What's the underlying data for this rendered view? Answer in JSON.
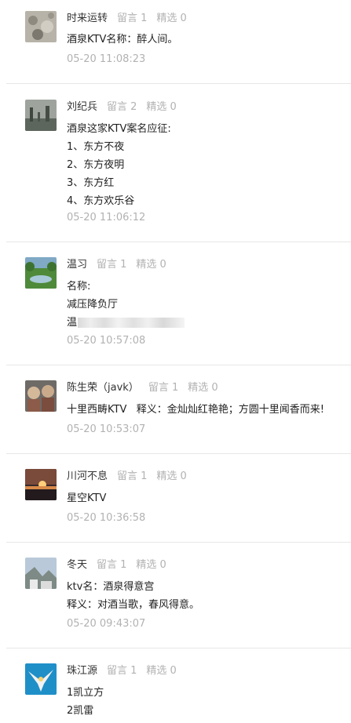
{
  "comments": [
    {
      "username": "时来运转",
      "replies": "留言 1",
      "featured": "精选 0",
      "lines": [
        "酒泉KTV名称：醉人间。"
      ],
      "time": "05-20 11:08:23"
    },
    {
      "username": "刘纪兵",
      "replies": "留言 2",
      "featured": "精选 0",
      "lines": [
        "酒泉这家KTV案名应征:",
        "1、东方不夜",
        "2、东方夜明",
        "3、东方红",
        "4、东方欢乐谷"
      ],
      "time": "05-20 11:06:12"
    },
    {
      "username": "温习",
      "replies": "留言 1",
      "featured": "精选 0",
      "lines": [
        "名称:",
        "减压降负厅",
        "温"
      ],
      "time": "05-20 10:57:08"
    },
    {
      "username": "陈生荣（javk）",
      "replies": "留言 1",
      "featured": "精选 0",
      "lines": [
        "十里西畴KTV   释义：金灿灿红艳艳；方圆十里闻香而来!"
      ],
      "time": "05-20 10:53:07"
    },
    {
      "username": "川河不息",
      "replies": "留言 1",
      "featured": "精选 0",
      "lines": [
        "星空KTV"
      ],
      "time": "05-20 10:36:58"
    },
    {
      "username": "冬天",
      "replies": "留言 1",
      "featured": "精选 0",
      "lines": [
        "ktv名：酒泉得意宫",
        "释义：对酒当歌，春风得意。"
      ],
      "time": "05-20 09:43:07"
    },
    {
      "username": "珠江源",
      "replies": "留言 1",
      "featured": "精选 0",
      "lines": [
        "1凯立方",
        "2凯雷"
      ],
      "time": ""
    }
  ]
}
